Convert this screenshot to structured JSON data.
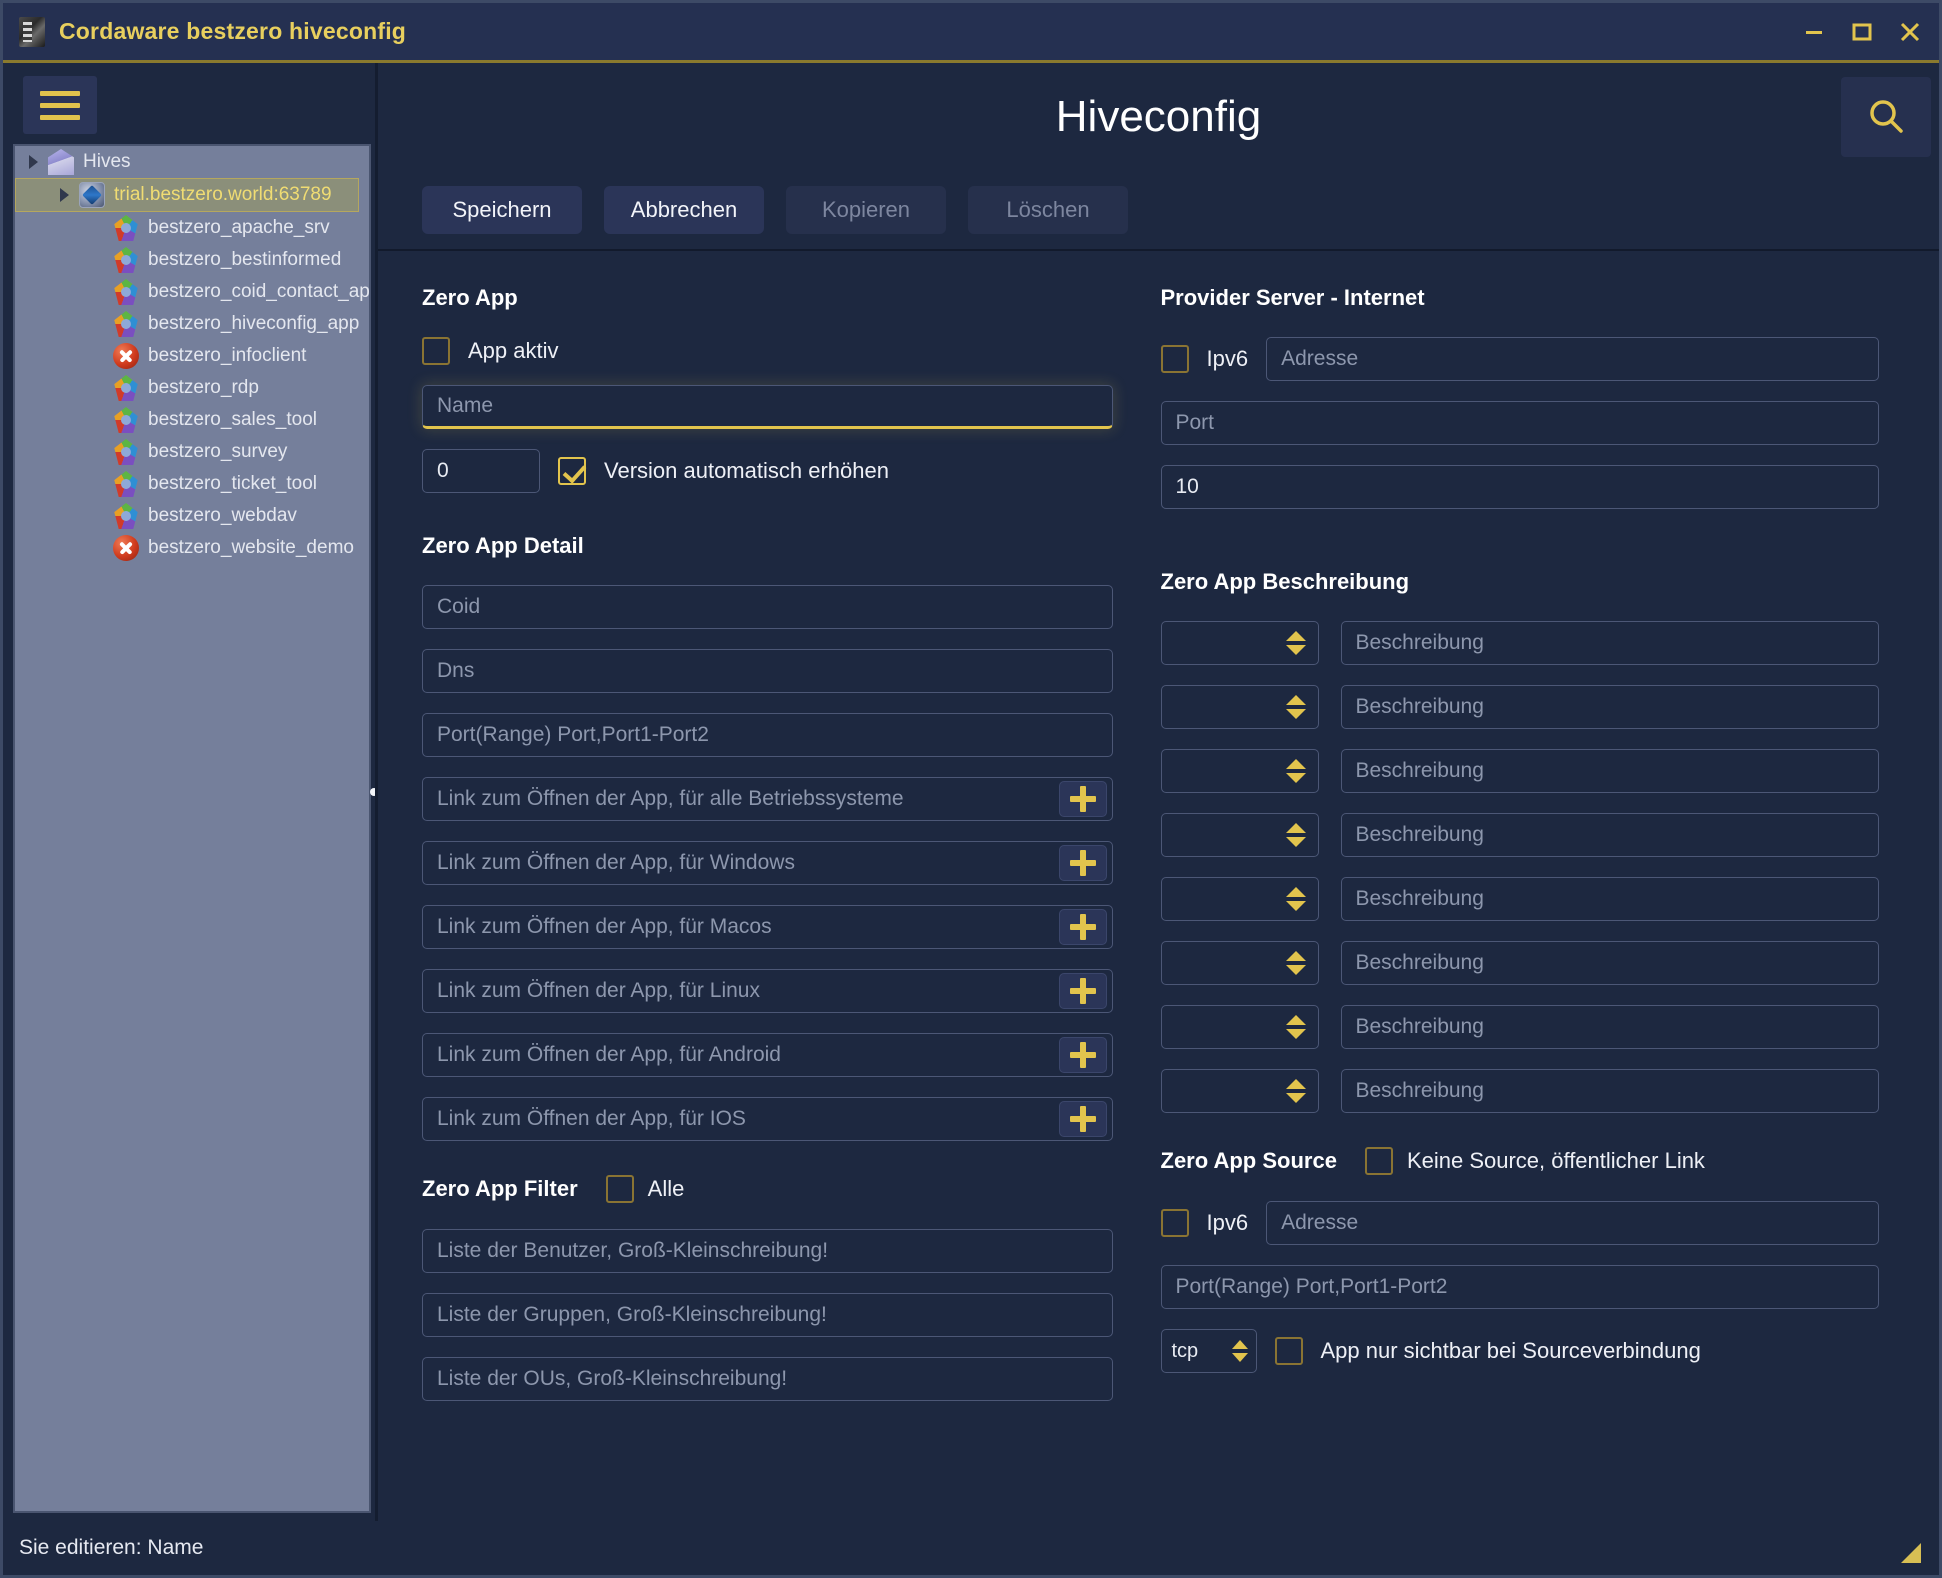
{
  "window": {
    "title": "Cordaware bestzero hiveconfig",
    "controls": {
      "minimize": "minimize-icon",
      "maximize": "maximize-icon",
      "close": "close-icon"
    }
  },
  "sidebar": {
    "menu_icon": "hamburger-icon",
    "tree": [
      {
        "label": "Hives",
        "level": 0,
        "icon": "house-icon",
        "expander": true,
        "selected": false
      },
      {
        "label": "trial.bestzero.world:63789",
        "level": 1,
        "icon": "hive-icon",
        "expander": true,
        "selected": true
      },
      {
        "label": "bestzero_apache_srv",
        "level": 2,
        "icon": "app-icon",
        "expander": false,
        "selected": false
      },
      {
        "label": "bestzero_bestinformed",
        "level": 2,
        "icon": "app-icon",
        "expander": false,
        "selected": false
      },
      {
        "label": "bestzero_coid_contact_ap",
        "level": 2,
        "icon": "app-icon",
        "expander": false,
        "selected": false
      },
      {
        "label": "bestzero_hiveconfig_app",
        "level": 2,
        "icon": "app-icon",
        "expander": false,
        "selected": false
      },
      {
        "label": "bestzero_infoclient",
        "level": 2,
        "icon": "error-icon",
        "expander": false,
        "selected": false
      },
      {
        "label": "bestzero_rdp",
        "level": 2,
        "icon": "app-icon",
        "expander": false,
        "selected": false
      },
      {
        "label": "bestzero_sales_tool",
        "level": 2,
        "icon": "app-icon",
        "expander": false,
        "selected": false
      },
      {
        "label": "bestzero_survey",
        "level": 2,
        "icon": "app-icon",
        "expander": false,
        "selected": false
      },
      {
        "label": "bestzero_ticket_tool",
        "level": 2,
        "icon": "app-icon",
        "expander": false,
        "selected": false
      },
      {
        "label": "bestzero_webdav",
        "level": 2,
        "icon": "app-icon",
        "expander": false,
        "selected": false
      },
      {
        "label": "bestzero_website_demo",
        "level": 2,
        "icon": "error-icon",
        "expander": false,
        "selected": false
      }
    ]
  },
  "header": {
    "title": "Hiveconfig",
    "search_icon": "search-icon"
  },
  "toolbar": {
    "save": "Speichern",
    "cancel": "Abbrechen",
    "copy": "Kopieren",
    "delete": "Löschen"
  },
  "zero_app": {
    "heading": "Zero App",
    "active_checkbox": {
      "label": "App aktiv",
      "checked": false
    },
    "name_placeholder": "Name",
    "name_value": "",
    "version_value": "0",
    "version_auto": {
      "label": "Version automatisch erhöhen",
      "checked": true
    }
  },
  "provider_server": {
    "heading": "Provider Server - Internet",
    "ipv6": {
      "label": "Ipv6",
      "checked": false
    },
    "address_placeholder": "Adresse",
    "port_placeholder": "Port",
    "count_value": "10"
  },
  "zero_app_detail": {
    "heading": "Zero App Detail",
    "coid_placeholder": "Coid",
    "dns_placeholder": "Dns",
    "port_placeholder": "Port(Range) Port,Port1-Port2",
    "links": [
      {
        "placeholder": "Link zum Öffnen der App, für alle Betriebssysteme",
        "add_icon": "plus-icon"
      },
      {
        "placeholder": "Link zum Öffnen der App, für Windows",
        "add_icon": "plus-icon"
      },
      {
        "placeholder": "Link zum Öffnen der App, für Macos",
        "add_icon": "plus-icon"
      },
      {
        "placeholder": "Link zum Öffnen der App, für Linux",
        "add_icon": "plus-icon"
      },
      {
        "placeholder": "Link zum Öffnen der App, für Android",
        "add_icon": "plus-icon"
      },
      {
        "placeholder": "Link zum Öffnen der App, für IOS",
        "add_icon": "plus-icon"
      }
    ]
  },
  "zero_app_beschreibung": {
    "heading": "Zero App Beschreibung",
    "rows": [
      {
        "spinner_value": "",
        "desc_placeholder": "Beschreibung"
      },
      {
        "spinner_value": "",
        "desc_placeholder": "Beschreibung"
      },
      {
        "spinner_value": "",
        "desc_placeholder": "Beschreibung"
      },
      {
        "spinner_value": "",
        "desc_placeholder": "Beschreibung"
      },
      {
        "spinner_value": "",
        "desc_placeholder": "Beschreibung"
      },
      {
        "spinner_value": "",
        "desc_placeholder": "Beschreibung"
      },
      {
        "spinner_value": "",
        "desc_placeholder": "Beschreibung"
      },
      {
        "spinner_value": "",
        "desc_placeholder": "Beschreibung"
      }
    ]
  },
  "zero_app_filter": {
    "heading": "Zero App Filter",
    "all_checkbox": {
      "label": "Alle",
      "checked": false
    },
    "users_placeholder": "Liste der Benutzer, Groß-Kleinschreibung!",
    "groups_placeholder": "Liste der Gruppen, Groß-Kleinschreibung!",
    "ous_placeholder": "Liste der OUs, Groß-Kleinschreibung!"
  },
  "zero_app_source": {
    "heading": "Zero App Source",
    "no_source_checkbox": {
      "label": "Keine Source, öffentlicher Link",
      "checked": false
    },
    "ipv6": {
      "label": "Ipv6",
      "checked": false
    },
    "address_placeholder": "Adresse",
    "port_placeholder": "Port(Range) Port,Port1-Port2",
    "protocol_value": "tcp",
    "visible_only_checkbox": {
      "label": "App nur sichtbar bei Sourceverbindung",
      "checked": false
    }
  },
  "statusbar": {
    "text": "Sie editieren: Name",
    "grip_icon": "resize-grip-icon"
  },
  "colors": {
    "accent": "#e2c44d",
    "window_bg": "#1d2840",
    "titlebar_bg": "#253051",
    "tree_bg": "#757f9b"
  }
}
